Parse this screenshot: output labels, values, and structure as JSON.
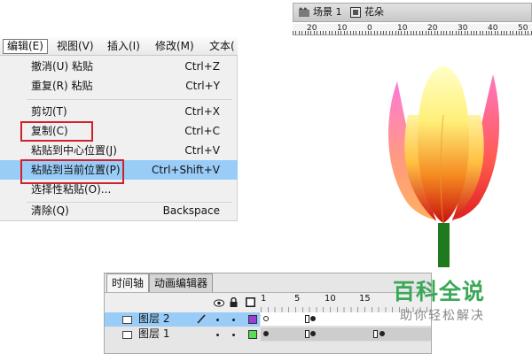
{
  "menubar": {
    "items": [
      "编辑(E)",
      "视图(V)",
      "插入(I)",
      "修改(M)",
      "文本("
    ],
    "active": "编辑(E)"
  },
  "edit_menu": {
    "items": [
      {
        "label": "撤消(U) 粘贴",
        "shortcut": "Ctrl+Z"
      },
      {
        "label": "重复(R) 粘贴",
        "shortcut": "Ctrl+Y"
      },
      {
        "label": "剪切(T)",
        "shortcut": "Ctrl+X"
      },
      {
        "label": "复制(C)",
        "shortcut": "Ctrl+C"
      },
      {
        "label": "粘贴到中心位置(J)",
        "shortcut": "Ctrl+V"
      },
      {
        "label": "粘贴到当前位置(P)",
        "shortcut": "Ctrl+Shift+V"
      },
      {
        "label": "选择性粘贴(O)...",
        "shortcut": ""
      },
      {
        "label": "清除(Q)",
        "shortcut": "Backspace"
      }
    ],
    "highlighted": "粘贴到当前位置(P)"
  },
  "scene": {
    "scene_label": "场景 1",
    "symbol_label": "花朵"
  },
  "ruler": {
    "labels": [
      "20",
      "10",
      "0",
      "10",
      "20",
      "30",
      "40",
      "50"
    ]
  },
  "timeline": {
    "tabs": [
      "时间轴",
      "动画编辑器"
    ],
    "frame_numbers": [
      "1",
      "5",
      "10",
      "15"
    ],
    "layers": [
      {
        "name": "图层 2",
        "color": "#9b3fd6",
        "selected": true
      },
      {
        "name": "图层 1",
        "color": "#55e055",
        "selected": false
      }
    ]
  },
  "watermark": {
    "title": "百科全说",
    "subtitle": "助你轻松解决"
  },
  "colors": {
    "menu_highlight": "#99ccf7",
    "annotation_box": "#d0202a",
    "stem": "#1f7a1f",
    "watermark_green": "#3aa856"
  }
}
